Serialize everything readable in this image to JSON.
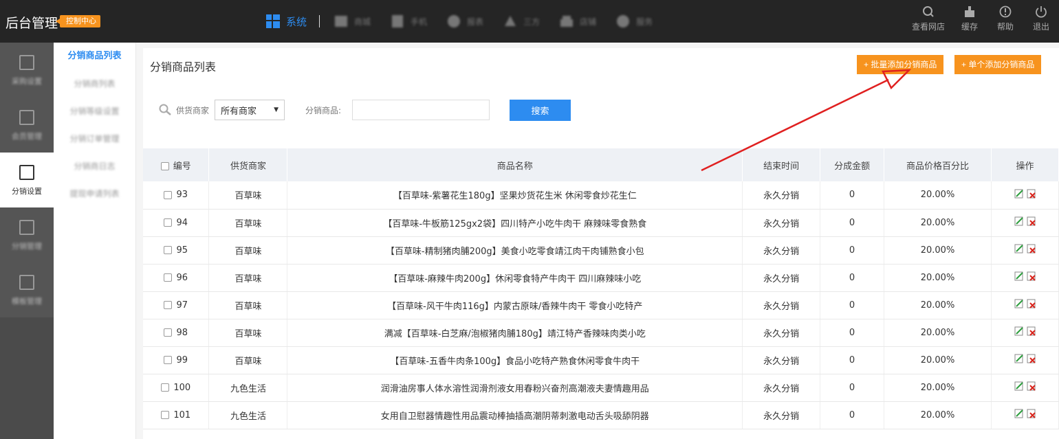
{
  "header": {
    "brand": "后台管理",
    "badge": "控制中心",
    "nav": [
      {
        "label": "系统",
        "active": true
      },
      {
        "label": "商城",
        "active": false
      },
      {
        "label": "手机",
        "active": false
      },
      {
        "label": "报表",
        "active": false
      },
      {
        "label": "三方",
        "active": false
      },
      {
        "label": "店铺",
        "active": false
      },
      {
        "label": "服务",
        "active": false
      }
    ],
    "right": [
      {
        "label": "查看网店",
        "icon": "search-icon"
      },
      {
        "label": "缓存",
        "icon": "broom-icon"
      },
      {
        "label": "帮助",
        "icon": "info-icon"
      },
      {
        "label": "退出",
        "icon": "power-icon"
      }
    ]
  },
  "leftbar": {
    "items": [
      {
        "label": "采购设置",
        "active": false
      },
      {
        "label": "会员管理",
        "active": false
      },
      {
        "label": "分销设置",
        "active": true
      },
      {
        "label": "分销管理",
        "active": false
      },
      {
        "label": "模板管理",
        "active": false
      }
    ]
  },
  "subbar": {
    "items": [
      {
        "label": "分销商品列表",
        "active": true
      },
      {
        "label": "分销商列表",
        "active": false
      },
      {
        "label": "分销等级设置",
        "active": false
      },
      {
        "label": "分销订单管理",
        "active": false
      },
      {
        "label": "分销商日志",
        "active": false
      },
      {
        "label": "提现申请列表",
        "active": false
      }
    ]
  },
  "main": {
    "title": "分销商品列表",
    "batch_add": "批量添加分销商品",
    "single_add": "单个添加分销商品",
    "search": {
      "supplier_label": "供货商家",
      "supplier_value": "所有商家",
      "product_label": "分销商品:",
      "product_value": "",
      "button": "搜索"
    }
  },
  "table": {
    "headers": [
      "编号",
      "供货商家",
      "商品名称",
      "结束时间",
      "分成金额",
      "商品价格百分比",
      "操作"
    ],
    "rows": [
      {
        "id": "93",
        "supplier": "百草味",
        "name": "【百草味-紫薯花生180g】坚果炒货花生米 休闲零食炒花生仁",
        "end": "永久分销",
        "amount": "0",
        "percent": "20.00%"
      },
      {
        "id": "94",
        "supplier": "百草味",
        "name": "【百草味-牛板筋125gx2袋】四川特产小吃牛肉干 麻辣味零食熟食",
        "end": "永久分销",
        "amount": "0",
        "percent": "20.00%"
      },
      {
        "id": "95",
        "supplier": "百草味",
        "name": "【百草味-精制猪肉脯200g】美食小吃零食靖江肉干肉铺熟食小包",
        "end": "永久分销",
        "amount": "0",
        "percent": "20.00%"
      },
      {
        "id": "96",
        "supplier": "百草味",
        "name": "【百草味-麻辣牛肉200g】休闲零食特产牛肉干 四川麻辣味小吃",
        "end": "永久分销",
        "amount": "0",
        "percent": "20.00%"
      },
      {
        "id": "97",
        "supplier": "百草味",
        "name": "【百草味-风干牛肉116g】内蒙古原味/香辣牛肉干 零食小吃特产",
        "end": "永久分销",
        "amount": "0",
        "percent": "20.00%"
      },
      {
        "id": "98",
        "supplier": "百草味",
        "name": "满减【百草味-白芝麻/泡椒猪肉脯180g】靖江特产香辣味肉类小吃",
        "end": "永久分销",
        "amount": "0",
        "percent": "20.00%"
      },
      {
        "id": "99",
        "supplier": "百草味",
        "name": "【百草味-五香牛肉条100g】食品小吃特产熟食休闲零食牛肉干",
        "end": "永久分销",
        "amount": "0",
        "percent": "20.00%"
      },
      {
        "id": "100",
        "supplier": "九色生活",
        "name": "润滑油房事人体水溶性润滑剂液女用春粉兴奋剂高潮液夫妻情趣用品",
        "end": "永久分销",
        "amount": "0",
        "percent": "20.00%"
      },
      {
        "id": "101",
        "supplier": "九色生活",
        "name": "女用自卫慰器情趣性用品震动棒抽插高潮阴蒂刺激电动舌头吸舔阴器",
        "end": "永久分销",
        "amount": "0",
        "percent": "20.00%"
      }
    ]
  }
}
